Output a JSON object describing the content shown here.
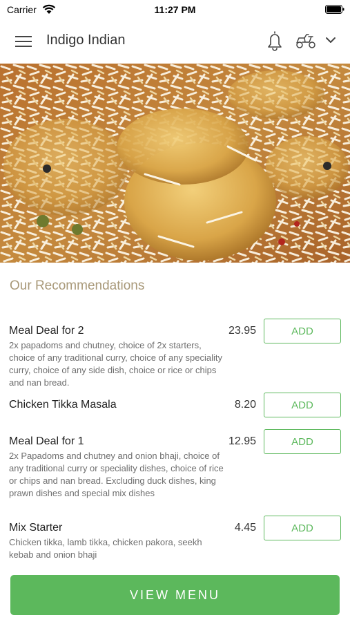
{
  "status_bar": {
    "carrier": "Carrier",
    "time": "11:27 PM"
  },
  "header": {
    "title": "Indigo Indian",
    "icons": [
      "hamburger-menu-icon",
      "bell-icon",
      "delivery-scooter-icon",
      "chevron-down-icon"
    ]
  },
  "hero_image": {
    "subject": "chicken biryani"
  },
  "recommendations": {
    "title": "Our Recommendations",
    "items": [
      {
        "name": "Meal Deal for 2",
        "description": "2x papadoms and chutney, choice of 2x starters, choice of any traditional curry, choice of any speciality curry, choice of any side dish, choice or rice or chips and nan bread.",
        "price": "23.95",
        "button": "ADD"
      },
      {
        "name": "Chicken Tikka Masala",
        "description": "",
        "price": "8.20",
        "button": "ADD"
      },
      {
        "name": "Meal Deal for 1",
        "description": "2x Papadoms and chutney and onion bhaji, choice of any traditional curry or speciality dishes, choice of rice or chips and nan bread. Excluding duck dishes, king prawn dishes and special mix dishes",
        "price": "12.95",
        "button": "ADD"
      },
      {
        "name": "Mix Starter",
        "description": "Chicken tikka, lamb tikka, chicken pakora, seekh kebab and onion bhaji",
        "price": "4.45",
        "button": "ADD"
      }
    ]
  },
  "footer": {
    "view_menu_label": "VIEW MENU"
  },
  "colors": {
    "accent_green": "#5cb85c",
    "section_title": "#a89878"
  }
}
